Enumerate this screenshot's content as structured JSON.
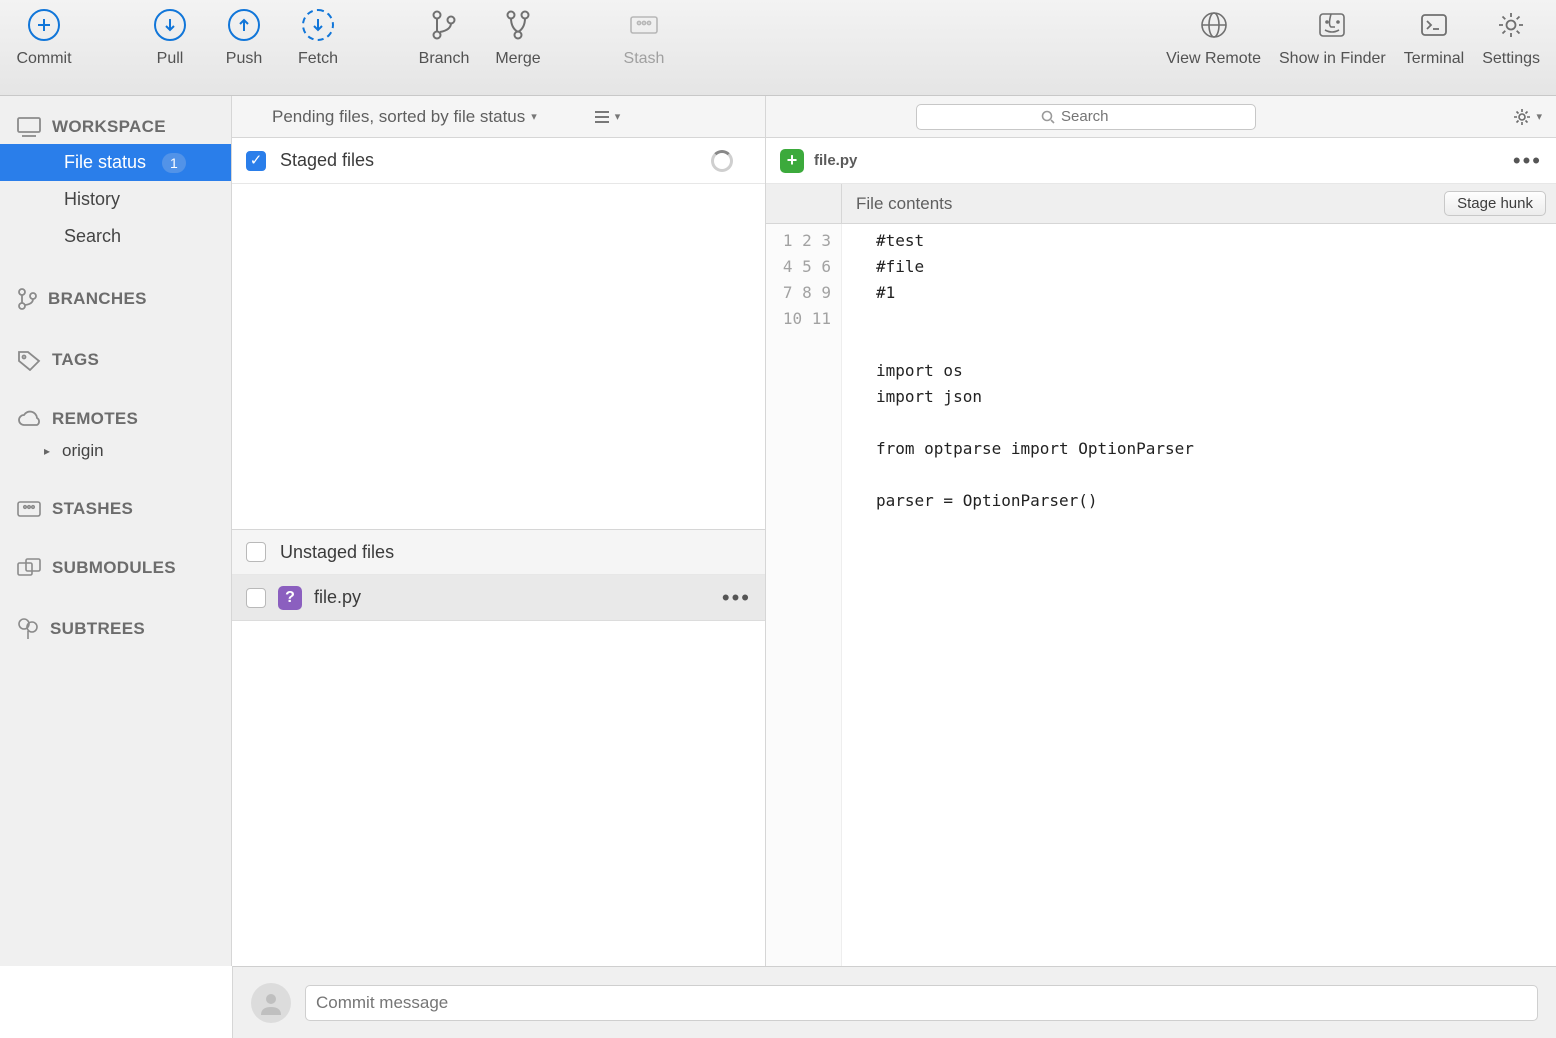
{
  "toolbar": {
    "commit": "Commit",
    "pull": "Pull",
    "push": "Push",
    "fetch": "Fetch",
    "branch": "Branch",
    "merge": "Merge",
    "stash": "Stash",
    "view_remote": "View Remote",
    "show_in_finder": "Show in Finder",
    "terminal": "Terminal",
    "settings": "Settings"
  },
  "sidebar": {
    "workspace": {
      "header": "WORKSPACE",
      "file_status": "File status",
      "badge": "1",
      "history": "History",
      "search": "Search"
    },
    "branches": {
      "header": "BRANCHES"
    },
    "tags": {
      "header": "TAGS"
    },
    "remotes": {
      "header": "REMOTES",
      "origin": "origin"
    },
    "stashes": {
      "header": "STASHES"
    },
    "submodules": {
      "header": "SUBMODULES"
    },
    "subtrees": {
      "header": "SUBTREES"
    }
  },
  "center": {
    "filter_label": "Pending files, sorted by file status",
    "staged_header": "Staged files",
    "unstaged_header": "Unstaged files",
    "file_name": "file.py",
    "file_badge": "?"
  },
  "right": {
    "search_placeholder": "Search",
    "file_name": "file.py",
    "hunk_label": "File contents",
    "stage_hunk": "Stage hunk",
    "code_lines": [
      "#test",
      "#file",
      "#1",
      "",
      "",
      "import os",
      "import json",
      "",
      "from optparse import OptionParser",
      "",
      "parser = OptionParser()"
    ]
  },
  "footer": {
    "commit_placeholder": "Commit message"
  }
}
